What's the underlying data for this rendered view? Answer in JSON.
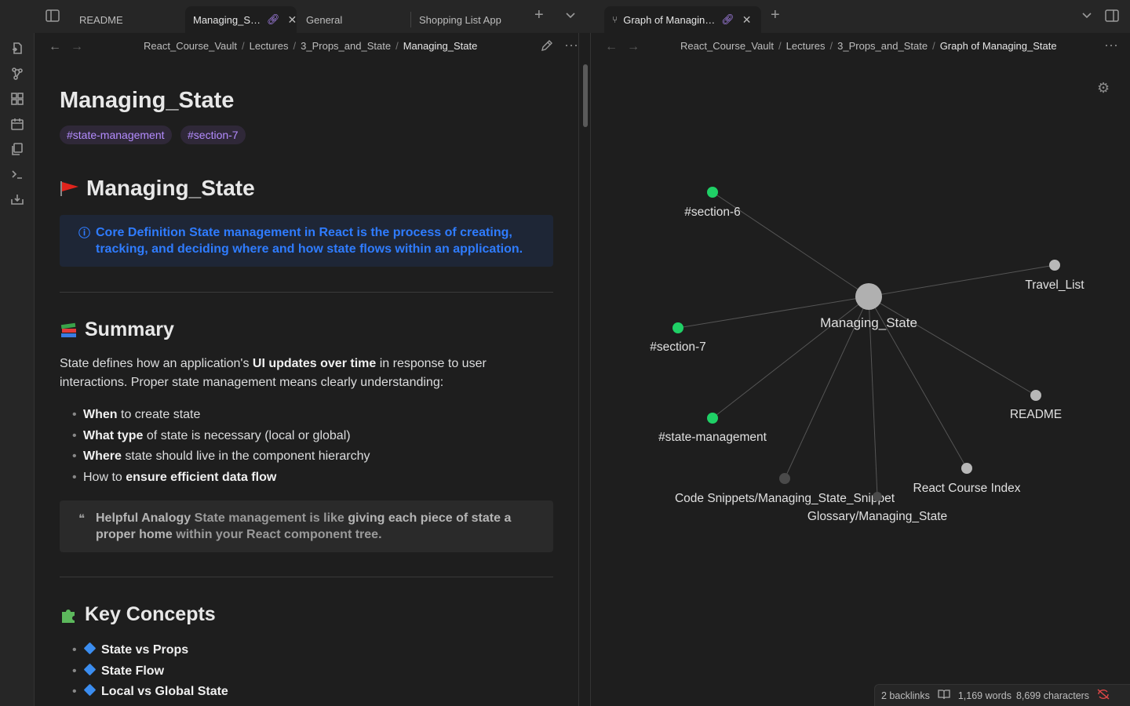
{
  "tabs": [
    {
      "label": "README"
    },
    {
      "label": "Managing_S…"
    },
    {
      "label": "General"
    },
    {
      "label": "Shopping List App"
    },
    {
      "label": "Graph of Managin…"
    }
  ],
  "left_pane": {
    "breadcrumb": [
      "React_Course_Vault",
      "Lectures",
      "3_Props_and_State",
      "Managing_State"
    ],
    "title": "Managing_State",
    "tags": [
      "#state-management",
      "#section-7"
    ],
    "heading1": "Managing_State",
    "definition": {
      "label": "Core Definition",
      "text_a": "State management in React is the process of",
      "bold_a": "creating,",
      "bold_b": "tracking",
      "text_b": ", and deciding",
      "bold_c": "where and how state flows",
      "text_c": "within an application."
    },
    "summary": {
      "heading": "Summary",
      "para_a": "State defines how an application's",
      "para_bold": "UI updates over time",
      "para_b": "in response to user interactions. Proper state management means clearly understanding:",
      "bullets": [
        {
          "bold": "When",
          "text": " to create state"
        },
        {
          "bold": "What type",
          "text": " of state is necessary (local or global)"
        },
        {
          "bold": "Where",
          "text": " state should live in the component hierarchy"
        },
        {
          "pre": "How to ",
          "bold": "ensure efficient data flow",
          "text": ""
        }
      ]
    },
    "analogy": {
      "label": "Helpful Analogy",
      "text_a": "State management is like",
      "bold_a": "giving each piece of state a proper home",
      "text_b": "within your React component tree."
    },
    "key_concepts": {
      "heading": "Key Concepts",
      "items": [
        "State vs Props",
        "State Flow",
        "Local vs Global State"
      ]
    }
  },
  "right_pane": {
    "breadcrumb": [
      "React_Course_Vault",
      "Lectures",
      "3_Props_and_State",
      "Graph of Managing_State"
    ],
    "graph": {
      "nodes": [
        {
          "label": "Managing_State",
          "type": "center"
        },
        {
          "label": "#section-6",
          "type": "tag"
        },
        {
          "label": "Travel_List",
          "type": "note"
        },
        {
          "label": "#section-7",
          "type": "tag"
        },
        {
          "label": "README",
          "type": "note"
        },
        {
          "label": "#state-management",
          "type": "tag"
        },
        {
          "label": "React Course Index",
          "type": "note"
        },
        {
          "label": "Code Snippets/Managing_State_Snippet",
          "type": "unresolved"
        },
        {
          "label": "Glossary/Managing_State",
          "type": "unresolved"
        }
      ],
      "colors": {
        "tag": "#1fd066",
        "note": "#b8b8b8",
        "center": "#b0b0b0",
        "unresolved": "#4a4a4a",
        "edge": "#555555"
      }
    }
  },
  "status": {
    "backlinks": "2 backlinks",
    "words": "1,169 words",
    "characters": "8,699 characters"
  },
  "icons": [
    "sidebar-toggle-icon",
    "link-icon",
    "close-icon",
    "plus-icon",
    "chevron-down-icon",
    "graph-icon",
    "right-sidebar-icon",
    "back-icon",
    "forward-icon",
    "pencil-icon",
    "more-icon",
    "gear-icon",
    "book-icon",
    "sync-off-icon"
  ]
}
